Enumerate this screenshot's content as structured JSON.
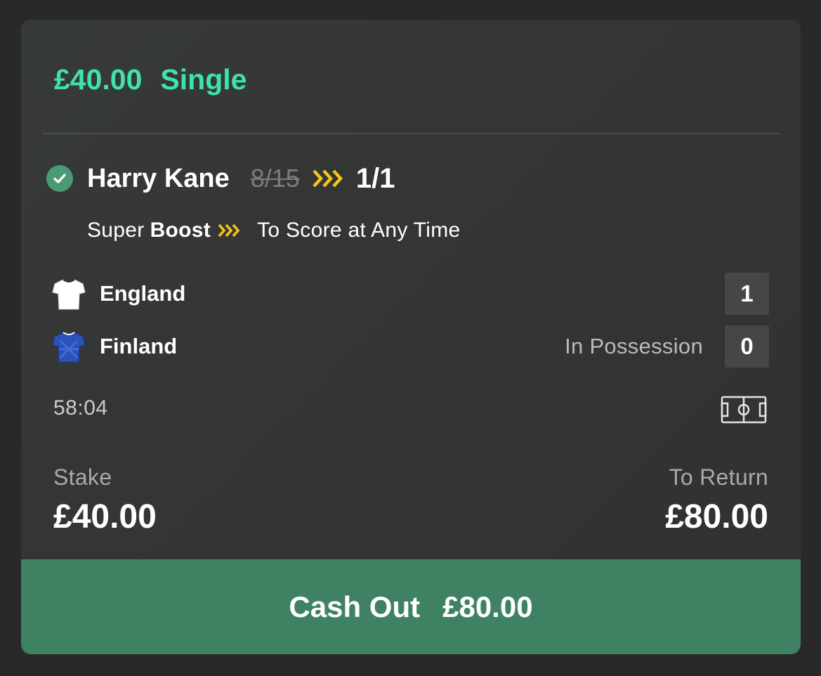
{
  "bet": {
    "amount": "£40.00",
    "type": "Single"
  },
  "selection": {
    "name": "Harry Kane",
    "old_odds": "8/15",
    "new_odds": "1/1",
    "market_prefix": "Super",
    "market_boost": "Boost",
    "market": "To Score at Any Time"
  },
  "teams": [
    {
      "name": "England",
      "score": "1",
      "status": "",
      "shirt_icon": "white-shirt-icon",
      "shirt_color": "#ffffff"
    },
    {
      "name": "Finland",
      "score": "0",
      "status": "In Possession",
      "shirt_icon": "blue-shirt-icon",
      "shirt_color": "#2a52b8"
    }
  ],
  "clock": "58:04",
  "stake": {
    "label": "Stake",
    "value": "£40.00"
  },
  "to_return": {
    "label": "To Return",
    "value": "£80.00"
  },
  "cash_out": {
    "label": "Cash Out",
    "amount": "£80.00"
  },
  "colors": {
    "accent_green": "#3fe3a8",
    "boost_yellow": "#f5c518",
    "cashout_bg": "#3f8263",
    "check_green": "#4b9a76"
  }
}
